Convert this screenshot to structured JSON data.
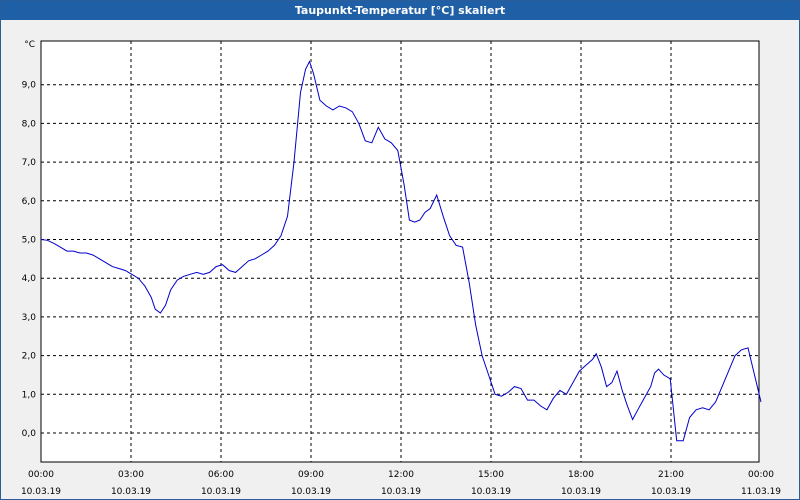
{
  "window": {
    "title": "Taupunkt-Temperatur [°C] skaliert"
  },
  "chart_data": {
    "type": "line",
    "title": "Taupunkt-Temperatur [°C] skaliert",
    "ylabel": "°C",
    "xlabel": "",
    "ylim": [
      -0.6,
      10.2
    ],
    "xlim": [
      0,
      24
    ],
    "grid": true,
    "legend": "none",
    "line_color": "#0000cc",
    "grid_color": "#000000",
    "y_ticks": [
      {
        "value": 0,
        "label": "0,0"
      },
      {
        "value": 1,
        "label": "1,0"
      },
      {
        "value": 2,
        "label": "2,0"
      },
      {
        "value": 3,
        "label": "3,0"
      },
      {
        "value": 4,
        "label": "4,0"
      },
      {
        "value": 5,
        "label": "5,0"
      },
      {
        "value": 6,
        "label": "6,0"
      },
      {
        "value": 7,
        "label": "7,0"
      },
      {
        "value": 8,
        "label": "8,0"
      },
      {
        "value": 9,
        "label": "9,0"
      }
    ],
    "x_ticks": [
      {
        "value": 0,
        "time": "00:00",
        "date": "10.03.19"
      },
      {
        "value": 3,
        "time": "03:00",
        "date": "10.03.19"
      },
      {
        "value": 6,
        "time": "06:00",
        "date": "10.03.19"
      },
      {
        "value": 9,
        "time": "09:00",
        "date": "10.03.19"
      },
      {
        "value": 12,
        "time": "12:00",
        "date": "10.03.19"
      },
      {
        "value": 15,
        "time": "15:00",
        "date": "10.03.19"
      },
      {
        "value": 18,
        "time": "18:00",
        "date": "10.03.19"
      },
      {
        "value": 21,
        "time": "21:00",
        "date": "10.03.19"
      },
      {
        "value": 24,
        "time": "00:00",
        "date": "11.03.19"
      }
    ],
    "series": [
      {
        "points": [
          [
            0.0,
            5.0
          ],
          [
            0.25,
            4.98
          ],
          [
            0.5,
            4.9
          ],
          [
            0.75,
            4.8
          ],
          [
            1.0,
            4.7
          ],
          [
            1.25,
            4.7
          ],
          [
            1.5,
            4.65
          ],
          [
            1.75,
            4.65
          ],
          [
            2.0,
            4.6
          ],
          [
            2.25,
            4.5
          ],
          [
            2.5,
            4.4
          ],
          [
            2.75,
            4.3
          ],
          [
            3.0,
            4.25
          ],
          [
            3.25,
            4.2
          ],
          [
            3.5,
            4.1
          ],
          [
            3.75,
            4.0
          ],
          [
            4.0,
            3.8
          ],
          [
            4.25,
            3.5
          ],
          [
            4.4,
            3.2
          ],
          [
            4.6,
            3.1
          ],
          [
            4.8,
            3.3
          ],
          [
            5.0,
            3.7
          ],
          [
            5.25,
            3.95
          ],
          [
            5.5,
            4.05
          ],
          [
            5.75,
            4.1
          ],
          [
            6.0,
            4.15
          ],
          [
            6.25,
            4.1
          ],
          [
            6.5,
            4.15
          ],
          [
            6.75,
            4.3
          ],
          [
            7.0,
            4.35
          ],
          [
            7.25,
            4.2
          ],
          [
            7.5,
            4.15
          ],
          [
            7.75,
            4.3
          ],
          [
            8.0,
            4.45
          ],
          [
            8.25,
            4.5
          ],
          [
            8.5,
            4.6
          ],
          [
            8.75,
            4.7
          ],
          [
            9.0,
            4.85
          ],
          [
            9.25,
            5.1
          ],
          [
            9.5,
            5.6
          ],
          [
            9.75,
            7.0
          ],
          [
            10.0,
            8.8
          ],
          [
            10.2,
            9.4
          ],
          [
            10.35,
            9.6
          ],
          [
            10.5,
            9.3
          ],
          [
            10.75,
            8.6
          ],
          [
            11.0,
            8.45
          ],
          [
            11.25,
            8.35
          ],
          [
            11.5,
            8.45
          ],
          [
            11.75,
            8.4
          ],
          [
            12.0,
            8.3
          ],
          [
            12.25,
            8.0
          ],
          [
            12.5,
            7.55
          ],
          [
            12.75,
            7.5
          ],
          [
            13.0,
            7.9
          ],
          [
            13.25,
            7.6
          ],
          [
            13.5,
            7.5
          ],
          [
            13.75,
            7.3
          ],
          [
            14.0,
            6.4
          ],
          [
            14.2,
            5.5
          ],
          [
            14.4,
            5.45
          ],
          [
            14.6,
            5.5
          ],
          [
            14.8,
            5.7
          ],
          [
            15.0,
            5.8
          ],
          [
            15.25,
            6.15
          ],
          [
            15.5,
            5.6
          ],
          [
            15.75,
            5.1
          ],
          [
            16.0,
            4.85
          ],
          [
            16.25,
            4.8
          ],
          [
            16.5,
            3.9
          ],
          [
            16.75,
            2.8
          ],
          [
            17.0,
            2.0
          ],
          [
            17.25,
            1.5
          ],
          [
            17.5,
            1.0
          ],
          [
            17.75,
            0.95
          ],
          [
            18.0,
            1.05
          ],
          [
            18.25,
            1.2
          ],
          [
            18.5,
            1.15
          ],
          [
            18.75,
            0.85
          ],
          [
            19.0,
            0.85
          ],
          [
            19.25,
            0.7
          ],
          [
            19.5,
            0.6
          ],
          [
            19.75,
            0.9
          ],
          [
            20.0,
            1.1
          ],
          [
            20.25,
            1.0
          ],
          [
            20.5,
            1.3
          ],
          [
            20.75,
            1.6
          ],
          [
            21.0,
            1.75
          ],
          [
            21.25,
            1.9
          ],
          [
            21.4,
            2.05
          ],
          [
            21.6,
            1.7
          ],
          [
            21.8,
            1.2
          ],
          [
            22.0,
            1.3
          ],
          [
            22.2,
            1.6
          ],
          [
            22.4,
            1.1
          ],
          [
            22.6,
            0.7
          ],
          [
            22.8,
            0.35
          ],
          [
            23.0,
            0.6
          ],
          [
            23.25,
            0.9
          ],
          [
            23.5,
            1.2
          ],
          [
            23.65,
            1.55
          ],
          [
            23.8,
            1.65
          ],
          [
            24.0,
            1.5
          ],
          [
            24.25,
            1.4
          ],
          [
            24.5,
            -0.2
          ],
          [
            24.75,
            -0.2
          ],
          [
            25.0,
            0.4
          ],
          [
            25.25,
            0.6
          ],
          [
            25.5,
            0.65
          ],
          [
            25.75,
            0.6
          ],
          [
            26.0,
            0.8
          ],
          [
            26.25,
            1.2
          ],
          [
            26.5,
            1.6
          ],
          [
            26.75,
            2.0
          ],
          [
            27.0,
            2.15
          ],
          [
            27.25,
            2.2
          ],
          [
            27.5,
            1.5
          ],
          [
            27.75,
            0.8
          ]
        ]
      }
    ]
  }
}
